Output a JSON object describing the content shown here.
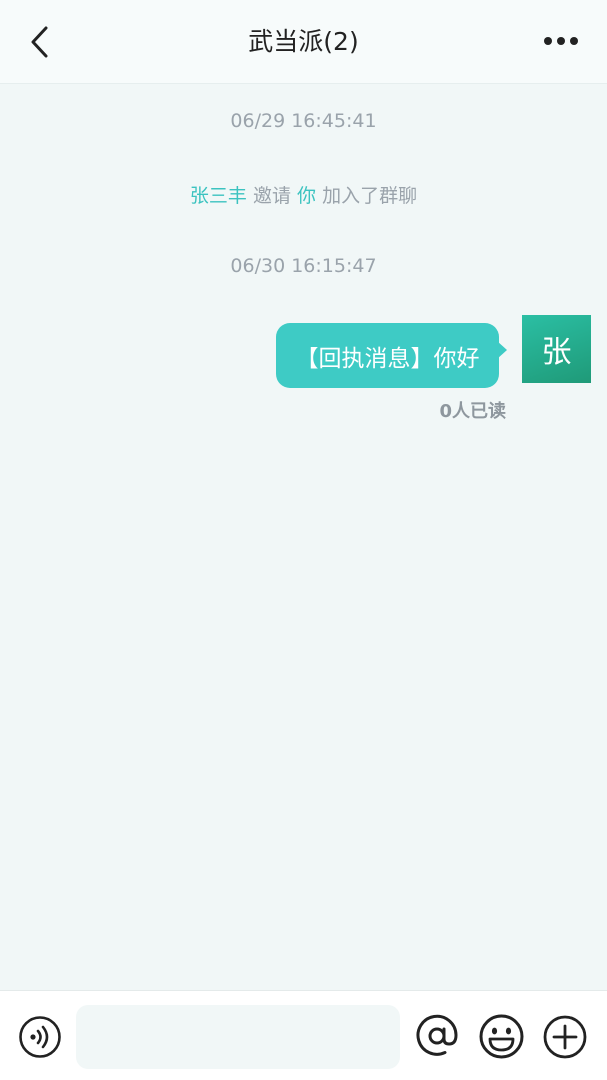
{
  "header": {
    "title": "武当派(2)",
    "back_icon": "chevron-left-icon",
    "more_icon": "more-dots-icon"
  },
  "messages": {
    "timestamp_1": "06/29 16:45:41",
    "system": {
      "inviter": "张三丰",
      "verb": " 邀请 ",
      "invitee": "你",
      "rest": " 加入了群聊"
    },
    "timestamp_2": "06/30 16:15:47",
    "outgoing": {
      "text": "【回执消息】你好",
      "avatar_text": "张",
      "read_status": "0人已读"
    }
  },
  "footer": {
    "voice_icon": "voice-icon",
    "input_value": "",
    "input_placeholder": "",
    "mention_icon": "at-icon",
    "emoji_icon": "emoji-icon",
    "plus_icon": "plus-icon"
  },
  "colors": {
    "accent": "#3ecbc5",
    "highlight": "#3cc3c0",
    "background": "#f1f7f7"
  }
}
